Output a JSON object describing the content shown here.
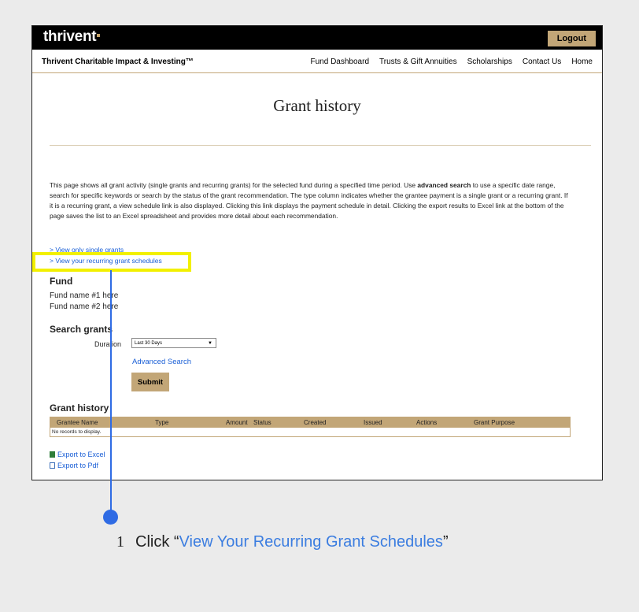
{
  "header": {
    "logo": "thrivent",
    "logout_label": "Logout"
  },
  "nav": {
    "brand": "Thrivent Charitable Impact & Investing™",
    "links": [
      "Fund Dashboard",
      "Trusts & Gift Annuities",
      "Scholarships",
      "Contact Us",
      "Home"
    ]
  },
  "page": {
    "title": "Grant history",
    "intro_pre": "This page shows all grant activity (single grants and recurring grants) for the selected fund during a specified time period. Use ",
    "intro_bold": "advanced search",
    "intro_post": " to use a specific date range, search for specific keywords or search by the status of the grant recommendation. The type column indicates whether the grantee payment is a single grant or a recurring grant. If it is a recurring grant, a view schedule link is also displayed. Clicking this link displays the payment schedule in detail. Clicking the export results to Excel link at the bottom of the page saves the list to an Excel spreadsheet and provides more detail about each recommendation.",
    "link_single": "> View only single grants",
    "link_recurring": "> View your recurring grant schedules"
  },
  "fund": {
    "heading": "Fund",
    "names": [
      "Fund name #1 here",
      "Fund name #2 here"
    ]
  },
  "search": {
    "heading": "Search grants",
    "duration_label": "Duration",
    "duration_value": "Last 30 Days",
    "advanced_label": "Advanced Search",
    "submit_label": "Submit"
  },
  "history": {
    "heading": "Grant history",
    "columns": [
      "Grantee Name",
      "Type",
      "Amount",
      "Status",
      "Created",
      "Issued",
      "Actions",
      "Grant Purpose"
    ],
    "empty_text": "No records to display."
  },
  "export": {
    "excel": "Export to Excel",
    "pdf": "Export to Pdf"
  },
  "callout": {
    "step": "1",
    "text_pre": "Click “",
    "text_link": "View Your Recurring Grant Schedules",
    "text_post": "”",
    "highlight_color": "#f2f000",
    "accent_color": "#2f6be4"
  }
}
